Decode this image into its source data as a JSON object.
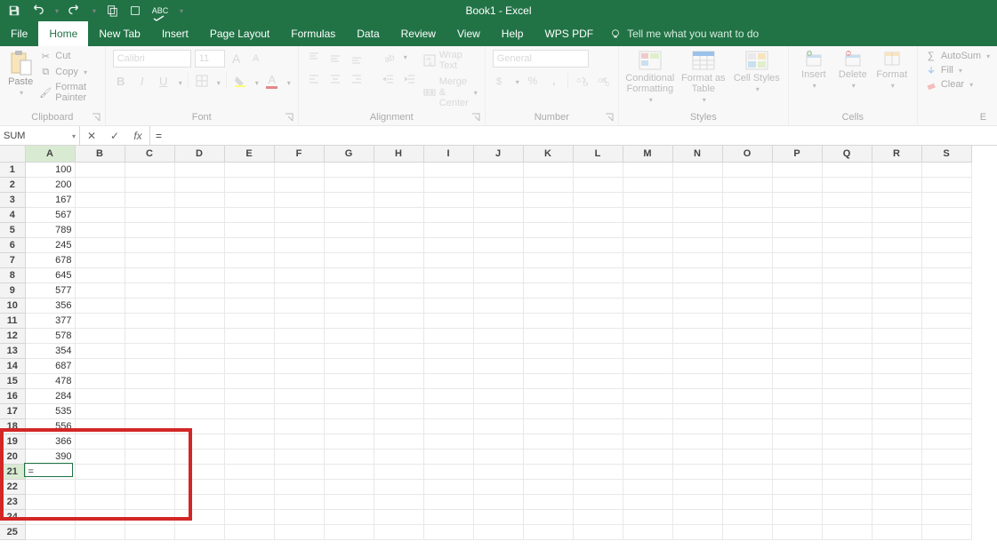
{
  "title": "Book1 - Excel",
  "qat": {
    "save": "save-icon",
    "undo": "undo-icon",
    "redo": "redo-icon",
    "touch": "touch-icon",
    "spell": "spell-icon"
  },
  "tabs": {
    "file": "File",
    "home": "Home",
    "newtab": "New Tab",
    "insert": "Insert",
    "pagelayout": "Page Layout",
    "formulas": "Formulas",
    "data": "Data",
    "review": "Review",
    "view": "View",
    "help": "Help",
    "wpspdf": "WPS PDF",
    "tellme": "Tell me what you want to do"
  },
  "ribbon": {
    "clipboard": {
      "label": "Clipboard",
      "paste": "Paste",
      "cut": "Cut",
      "copy": "Copy",
      "format_painter": "Format Painter"
    },
    "font": {
      "label": "Font",
      "name": "Calibri",
      "size": "11",
      "bold": "B",
      "italic": "I",
      "underline": "U",
      "increase": "A",
      "decrease": "A",
      "fontcolor": "A"
    },
    "alignment": {
      "label": "Alignment",
      "wrap": "Wrap Text",
      "merge": "Merge & Center"
    },
    "number": {
      "label": "Number",
      "format": "General",
      "percent": "%",
      "comma": ","
    },
    "styles": {
      "label": "Styles",
      "cond": "Conditional Formatting",
      "table": "Format as Table",
      "cell": "Cell Styles"
    },
    "cells": {
      "label": "Cells",
      "insert": "Insert",
      "delete": "Delete",
      "format": "Format"
    },
    "editing": {
      "label": "E",
      "autosum": "AutoSum",
      "fill": "Fill",
      "clear": "Clear"
    }
  },
  "namebox": "SUM",
  "formula": "=",
  "columns": [
    "A",
    "B",
    "C",
    "D",
    "E",
    "F",
    "G",
    "H",
    "I",
    "J",
    "K",
    "L",
    "M",
    "N",
    "O",
    "P",
    "Q",
    "R",
    "S"
  ],
  "row_count": 25,
  "data_col_a": [
    "100",
    "200",
    "167",
    "567",
    "789",
    "245",
    "678",
    "645",
    "577",
    "356",
    "377",
    "578",
    "354",
    "687",
    "478",
    "284",
    "535",
    "556",
    "366",
    "390",
    "="
  ],
  "active_cell": {
    "row": 21,
    "col": "A"
  },
  "annotation_box": {
    "top_row": 19,
    "bottom_row": 24,
    "left_col": "rowhead",
    "right_col": "C"
  }
}
